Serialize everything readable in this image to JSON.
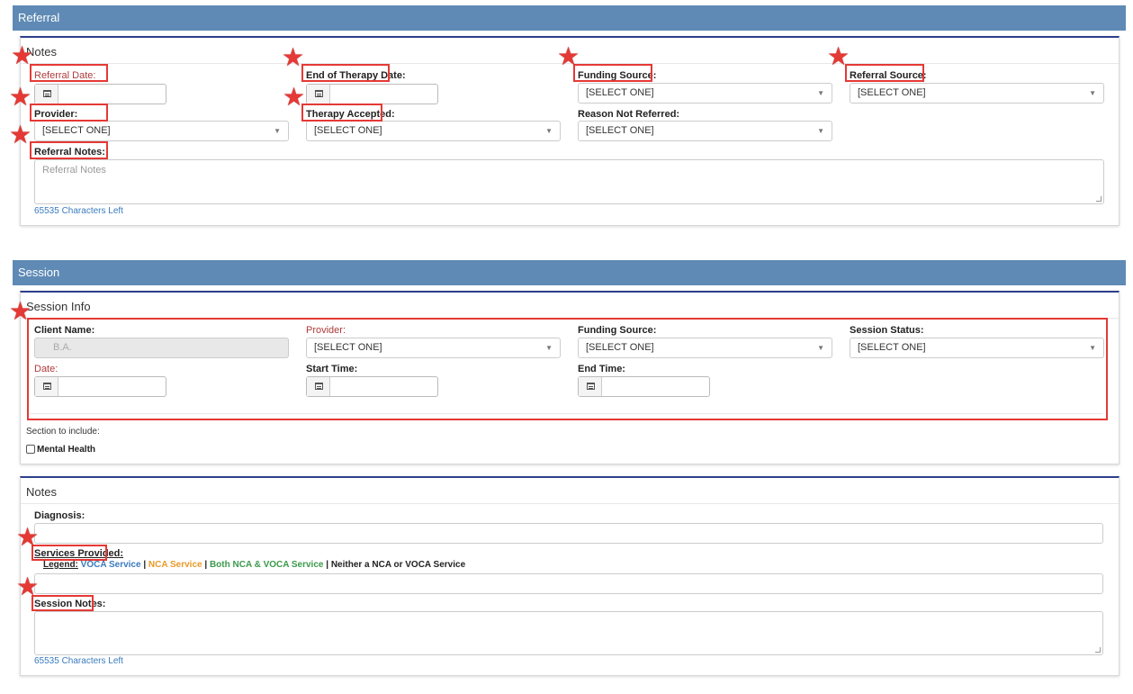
{
  "referral": {
    "header": "Referral",
    "notes_title": "Notes",
    "fields": {
      "referral_date": "Referral Date:",
      "end_of_therapy_date": "End of Therapy Date:",
      "funding_source": "Funding Source:",
      "referral_source": "Referral Source:",
      "provider": "Provider:",
      "therapy_accepted": "Therapy Accepted:",
      "reason_not_referred": "Reason Not Referred:",
      "referral_notes": "Referral Notes:"
    },
    "select_placeholder": "[SELECT ONE]",
    "notes_placeholder": "Referral Notes",
    "chars_left": "65535 Characters Left"
  },
  "session": {
    "header": "Session",
    "info_title": "Session Info",
    "fields": {
      "client_name": "Client Name:",
      "client_name_value": "B.A.",
      "provider": "Provider:",
      "funding_source": "Funding Source:",
      "session_status": "Session Status:",
      "date": "Date:",
      "start_time": "Start Time:",
      "end_time": "End Time:"
    },
    "select_placeholder": "[SELECT ONE]",
    "section_to_include": "Section to include:",
    "mental_health": "Mental Health"
  },
  "session_notes": {
    "title": "Notes",
    "diagnosis": "Diagnosis:",
    "services_provided": "Services Provided:",
    "legend_label": "Legend:",
    "legend": {
      "voca": "VOCA Service",
      "nca": "NCA Service",
      "both": "Both NCA & VOCA Service",
      "neither": "Neither a NCA or VOCA Service",
      "sep": " | "
    },
    "session_notes_label": "Session Notes:",
    "chars_left": "65535 Characters Left"
  },
  "colors": {
    "header": "#5f8ab5",
    "annotation": "#e53935",
    "voca": "#3a7bbf",
    "nca": "#e69a28",
    "both": "#3b9a4b"
  }
}
